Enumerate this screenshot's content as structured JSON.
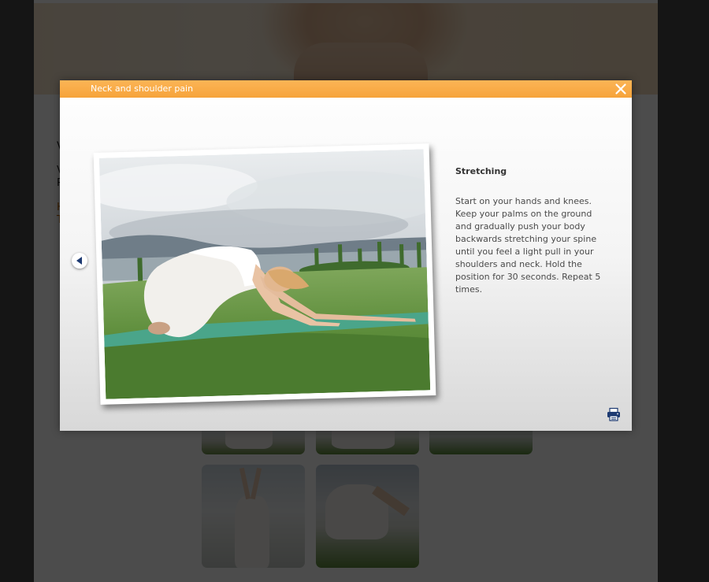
{
  "background_page": {
    "heading_fragment": "V",
    "text_fragment_1": "V",
    "text_fragment_2": "P",
    "link_fragment_1": "H",
    "link_fragment_2": "T"
  },
  "modal": {
    "title": "Neck and shoulder pain",
    "heading": "Stretching",
    "description": "Start on your hands and knees. Keep your palms on the ground and gradually push your body backwards stretching your spine until you feel a light pull in your shoulders and neck. Hold the position for 30 seconds. Repeat 5 times."
  },
  "icons": {
    "close": "close-icon",
    "previous": "chevron-left-icon",
    "print": "printer-icon"
  },
  "colors": {
    "header_orange": "#f6a33a",
    "icon_navy": "#1d3a72",
    "link_orange": "#c36a00"
  }
}
